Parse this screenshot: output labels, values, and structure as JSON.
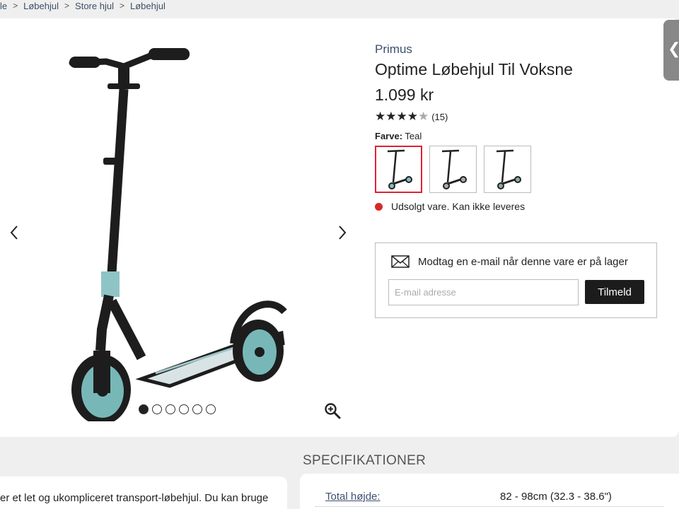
{
  "breadcrumb": {
    "items": [
      "le",
      "Løbehjul",
      "Store hjul",
      "Løbehjul"
    ]
  },
  "gallery": {
    "image_count": 6,
    "active_index": 0
  },
  "product": {
    "brand": "Primus",
    "title": "Optime Løbehjul Til Voksne",
    "price": "1.099 kr",
    "rating_stars": 4,
    "rating_count": "(15)",
    "color_label": "Farve:",
    "color_value": "Teal",
    "stock_text": "Udsolgt vare. Kan ikke leveres"
  },
  "notify": {
    "heading": "Modtag en e-mail når denne vare er på lager",
    "email_placeholder": "E-mail adresse",
    "subscribe_label": "Tilmeld"
  },
  "side_tab": {
    "label": "❮"
  },
  "specs": {
    "heading": "SPECIFIKATIONER",
    "rows": [
      {
        "label": "Total højde:",
        "value": "82 - 98cm (32.3 - 38.6\")"
      }
    ]
  },
  "description": {
    "text": "er et let og ukompliceret transport-løbehjul. Du kan bruge"
  },
  "colors": {
    "accent_red": "#d62a2a",
    "brand_blue": "#3d5170",
    "button_dark": "#1c1c1c",
    "scooter_teal": "#7fbfbf"
  }
}
